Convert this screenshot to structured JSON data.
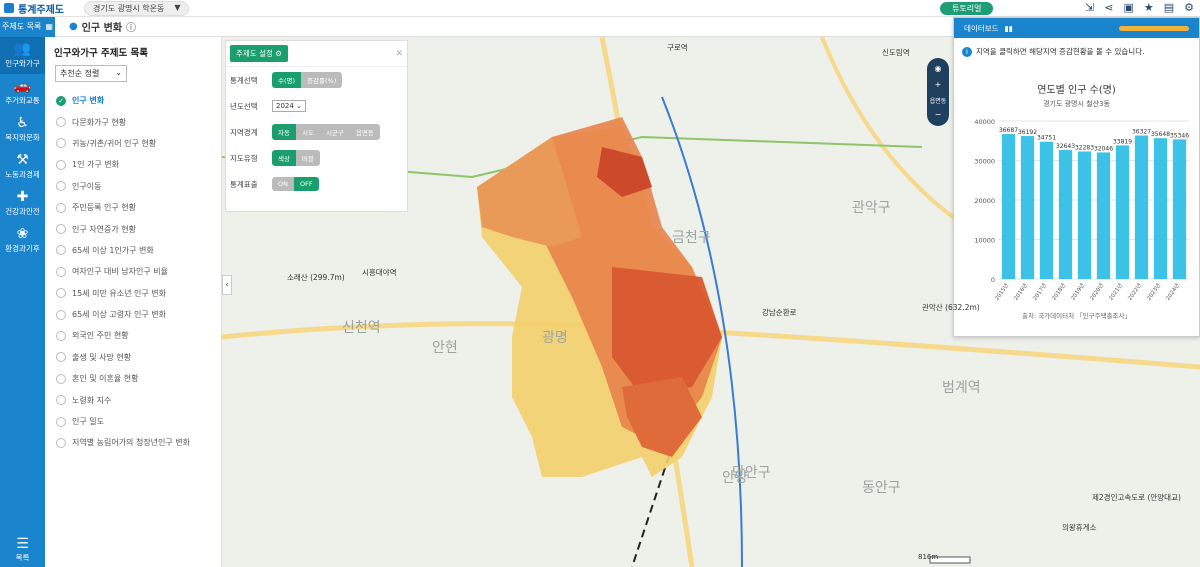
{
  "app": {
    "title": "통계주제도",
    "region": "경기도 광명시 학온동",
    "tutorial": "튜토리얼"
  },
  "subbar": {
    "category_btn": "주제도 목록",
    "page_title": "인구 변화"
  },
  "rail": [
    {
      "label": "인구와가구",
      "icon": "people-icon"
    },
    {
      "label": "주거와교통",
      "icon": "car-icon"
    },
    {
      "label": "복지와문화",
      "icon": "culture-icon"
    },
    {
      "label": "노동과경제",
      "icon": "worker-icon"
    },
    {
      "label": "건강과안전",
      "icon": "health-icon"
    },
    {
      "label": "환경과기후",
      "icon": "environment-icon"
    }
  ],
  "rail_menu": "목록",
  "panel": {
    "title": "인구와가구 주제도 목록",
    "sort": "추천순 정렬",
    "items": [
      "인구 변화",
      "다문화가구 현황",
      "귀농/귀촌/귀어 인구 현황",
      "1인 가구 변화",
      "인구이동",
      "주민등록 인구 현황",
      "인구 자연증가 현황",
      "65세 이상 1인가구 변화",
      "여자인구 대비 남자인구 비율",
      "15세 미만 유소년 인구 변화",
      "65세 이상 고령자 인구 변화",
      "외국인 주민 현황",
      "출생 및 사망 현황",
      "혼인 및 이혼율 현황",
      "노령화 지수",
      "인구 밀도",
      "지역별 농림어가의 청장년인구 변화"
    ]
  },
  "settings": {
    "button": "주제도 설정",
    "rows": [
      {
        "label": "통계선택",
        "opts": [
          "수(명)",
          "증감률(%)"
        ],
        "sel": 0
      },
      {
        "label": "년도선택",
        "year": "2024"
      },
      {
        "label": "지역경계",
        "opts": [
          "자동",
          "시도",
          "시군구",
          "읍면동"
        ],
        "sel": 0
      },
      {
        "label": "지도유형",
        "opts": [
          "색상",
          "버블"
        ],
        "sel": 0
      },
      {
        "label": "통계표출",
        "opts": [
          "ON",
          "OFF"
        ],
        "sel": 1
      }
    ]
  },
  "map": {
    "zoom_label": "읍면동",
    "scale": "816m",
    "labels": [
      "구로역",
      "신도림역",
      "금천구",
      "광명",
      "안양",
      "만안구",
      "동안구",
      "관악구",
      "소래산 (299.7m)",
      "시흥대야역",
      "신천역",
      "안현",
      "관악산 (632.2m)",
      "범계역",
      "의왕휴게소",
      "강남순환로",
      "제2경인고속도로 (안양대교)"
    ]
  },
  "dashboard": {
    "header": "데이터보드",
    "note": "지역을 클릭하면 해당지역 증감현황을 볼 수 있습니다.",
    "source": "출처: 국가데이터처 「인구주택총조사」"
  },
  "chart_data": {
    "type": "bar",
    "title": "연도별 인구 수(명)",
    "subtitle": "경기도 광명시 철산3동",
    "categories": [
      "2015년",
      "2016년",
      "2017년",
      "2018년",
      "2019년",
      "2020년",
      "2021년",
      "2022년",
      "2023년",
      "2024년"
    ],
    "values": [
      36687,
      36192,
      34751,
      32643,
      32283,
      32046,
      33819,
      36327,
      35648,
      35346
    ],
    "ylim": [
      0,
      40000
    ],
    "yticks": [
      0,
      10000,
      20000,
      30000,
      40000
    ],
    "color": "#3cc2e6"
  }
}
